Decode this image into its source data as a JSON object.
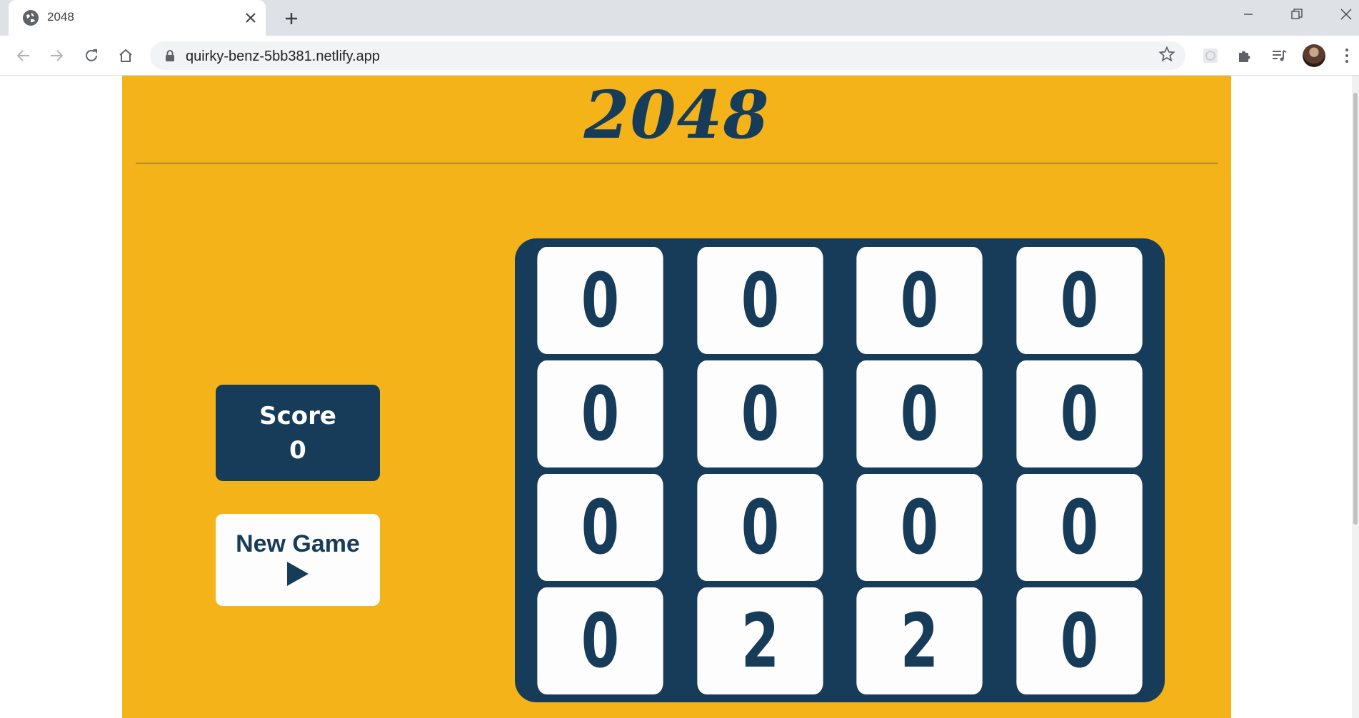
{
  "browser": {
    "tab_title": "2048",
    "url": "quirky-benz-5bb381.netlify.app",
    "icons": [
      "globe-icon",
      "close-icon",
      "plus-icon",
      "minimize-icon",
      "restore-icon",
      "close-window-icon",
      "back-icon",
      "forward-icon",
      "reload-icon",
      "home-icon",
      "lock-icon",
      "star-icon",
      "extension-icon",
      "puzzle-icon",
      "media-icon",
      "menu-icon"
    ]
  },
  "game": {
    "title": "2048",
    "score_label": "Score",
    "score_value": "0",
    "new_game_label": "New Game",
    "colors": {
      "background": "#f5b31a",
      "primary": "#173c5a",
      "tile": "#fdfdfd"
    },
    "grid": [
      [
        "0",
        "0",
        "0",
        "0"
      ],
      [
        "0",
        "0",
        "0",
        "0"
      ],
      [
        "0",
        "0",
        "0",
        "0"
      ],
      [
        "0",
        "2",
        "2",
        "0"
      ]
    ]
  }
}
